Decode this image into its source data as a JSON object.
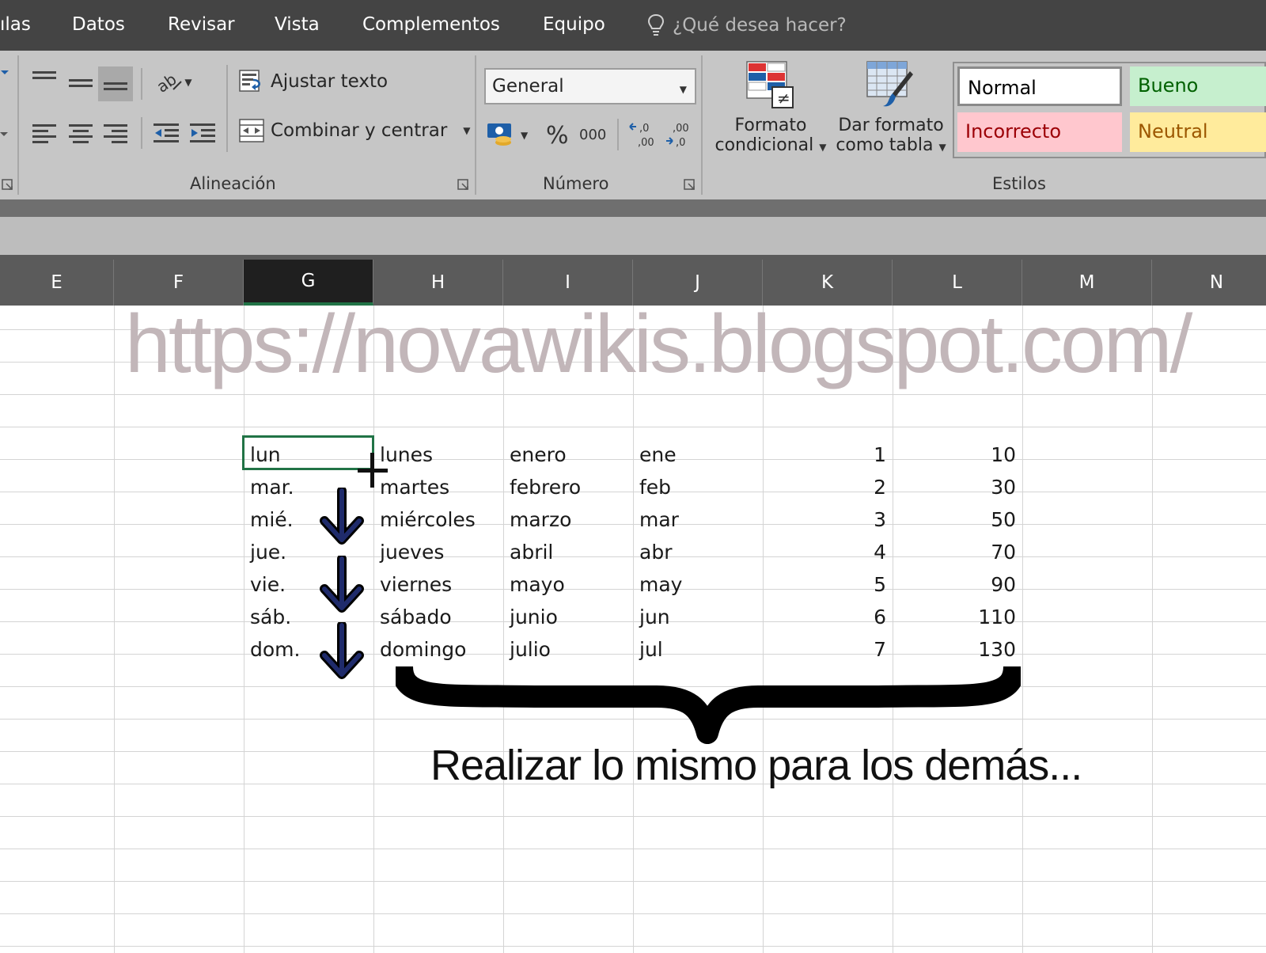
{
  "menu": {
    "items": [
      "ılas",
      "Datos",
      "Revisar",
      "Vista",
      "Complementos",
      "Equipo"
    ],
    "tell_me": "¿Qué desea hacer?"
  },
  "ribbon": {
    "alignment": {
      "wrap_text": "Ajustar texto",
      "merge_center": "Combinar y centrar",
      "label": "Alineación"
    },
    "number": {
      "format": "General",
      "percent": "%",
      "thousands": "000",
      "label": "Número"
    },
    "styles": {
      "conditional_format": [
        "Formato",
        "condicional"
      ],
      "format_as_table": [
        "Dar formato",
        "como tabla"
      ],
      "cells": [
        {
          "name": "Normal",
          "bg": "#ffffff",
          "fg": "#000000"
        },
        {
          "name": "Bueno",
          "bg": "#c6efce",
          "fg": "#006100"
        },
        {
          "name": "Incorrecto",
          "bg": "#ffc7ce",
          "fg": "#9c0006"
        },
        {
          "name": "Neutral",
          "bg": "#ffeb9c",
          "fg": "#9c5700"
        }
      ],
      "label": "Estilos"
    }
  },
  "columns": [
    "E",
    "F",
    "G",
    "H",
    "I",
    "J",
    "K",
    "L",
    "M",
    "N"
  ],
  "selected_column": "G",
  "watermark": "https://novawikis.blogspot.com/",
  "table": {
    "G": [
      "lun",
      "mar.",
      "mié.",
      "jue.",
      "vie.",
      "sáb.",
      "dom."
    ],
    "H": [
      "lunes",
      "martes",
      "miércoles",
      "jueves",
      "viernes",
      "sábado",
      "domingo"
    ],
    "I": [
      "enero",
      "febrero",
      "marzo",
      "abril",
      "mayo",
      "junio",
      "julio"
    ],
    "J": [
      "ene",
      "feb",
      "mar",
      "abr",
      "may",
      "jun",
      "jul"
    ],
    "K": [
      "1",
      "2",
      "3",
      "4",
      "5",
      "6",
      "7"
    ],
    "L": [
      "10",
      "30",
      "50",
      "70",
      "90",
      "110",
      "130"
    ]
  },
  "annotation": "Realizar lo mismo para los demás...",
  "colors": {
    "selection": "#217346",
    "arrow": "#1f2b6b"
  }
}
